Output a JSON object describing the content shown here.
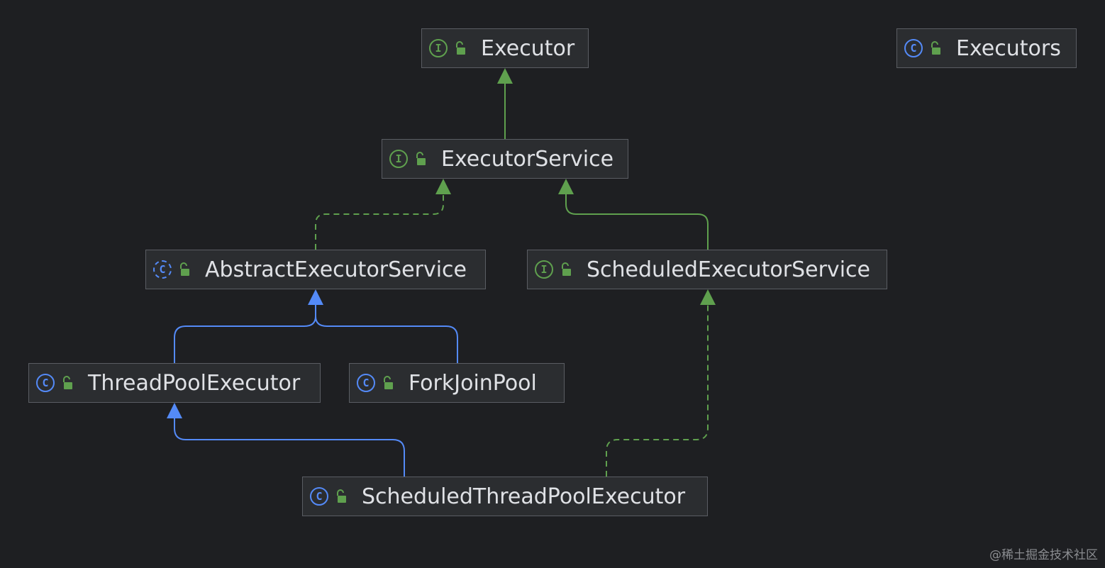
{
  "colors": {
    "background": "#1e1f22",
    "node_fill": "#2b2d30",
    "node_border": "#5a5d63",
    "interface_green": "#5fa04e",
    "class_blue": "#548af7",
    "text": "#dfe1e5"
  },
  "nodes": {
    "executor": {
      "label": "Executor",
      "kind": "interface",
      "icon": "interface-icon"
    },
    "executors": {
      "label": "Executors",
      "kind": "class",
      "icon": "class-icon"
    },
    "executor_service": {
      "label": "ExecutorService",
      "kind": "interface",
      "icon": "interface-icon"
    },
    "abstract_executor_service": {
      "label": "AbstractExecutorService",
      "kind": "abstract",
      "icon": "abstract-class-icon"
    },
    "scheduled_executor_service": {
      "label": "ScheduledExecutorService",
      "kind": "interface",
      "icon": "interface-icon"
    },
    "thread_pool_executor": {
      "label": "ThreadPoolExecutor",
      "kind": "class",
      "icon": "class-icon"
    },
    "fork_join_pool": {
      "label": "ForkJoinPool",
      "kind": "class",
      "icon": "class-icon"
    },
    "scheduled_thread_pool_executor": {
      "label": "ScheduledThreadPoolExecutor",
      "kind": "class",
      "icon": "class-icon"
    }
  },
  "edges": [
    {
      "from": "executor_service",
      "to": "executor",
      "type": "extends-interface",
      "style": "solid",
      "color": "#5fa04e"
    },
    {
      "from": "abstract_executor_service",
      "to": "executor_service",
      "type": "implements",
      "style": "dashed",
      "color": "#5fa04e"
    },
    {
      "from": "scheduled_executor_service",
      "to": "executor_service",
      "type": "extends-interface",
      "style": "solid",
      "color": "#5fa04e"
    },
    {
      "from": "thread_pool_executor",
      "to": "abstract_executor_service",
      "type": "extends",
      "style": "solid",
      "color": "#548af7"
    },
    {
      "from": "fork_join_pool",
      "to": "abstract_executor_service",
      "type": "extends",
      "style": "solid",
      "color": "#548af7"
    },
    {
      "from": "scheduled_thread_pool_executor",
      "to": "thread_pool_executor",
      "type": "extends",
      "style": "solid",
      "color": "#548af7"
    },
    {
      "from": "scheduled_thread_pool_executor",
      "to": "scheduled_executor_service",
      "type": "implements",
      "style": "dashed",
      "color": "#5fa04e"
    }
  ],
  "watermark": "@稀土掘金技术社区"
}
